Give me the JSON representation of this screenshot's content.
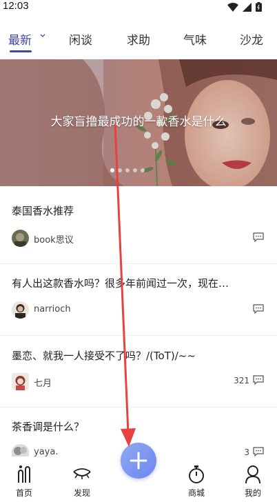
{
  "status_bar": {
    "time": "12:03"
  },
  "tabs": [
    {
      "label": "最新",
      "active": true
    },
    {
      "label": "闲谈"
    },
    {
      "label": "求助"
    },
    {
      "label": "气味"
    },
    {
      "label": "沙龙"
    }
  ],
  "banner": {
    "text": "大家盲撸最成功的一款香水是什么",
    "dot_count": 5,
    "active_dot": 0
  },
  "posts": [
    {
      "title": "泰国香水推荐",
      "author": "book思议",
      "comment_count": ""
    },
    {
      "title": "有人出这款香水吗？很多年前闻过一次，现在…",
      "author": "narrioch",
      "comment_count": ""
    },
    {
      "title": "墨恋、就我一人接受不了吗？/(ToT)/~~",
      "author": "七月",
      "comment_count": "321"
    },
    {
      "title": "茶香调是什么？",
      "author": "yaya.",
      "comment_count": "3"
    }
  ],
  "bottom_nav": {
    "items": [
      {
        "label": "首页",
        "icon": "home-icon"
      },
      {
        "label": "发现",
        "icon": "eye-icon"
      },
      {
        "label": "商城",
        "icon": "stopwatch-icon"
      },
      {
        "label": "我的",
        "icon": "user-icon"
      }
    ],
    "fab_icon": "plus-icon"
  },
  "colors": {
    "accent": "#3c47a8",
    "fab": "#7a90ef",
    "annotation_arrow": "#e8413f"
  }
}
